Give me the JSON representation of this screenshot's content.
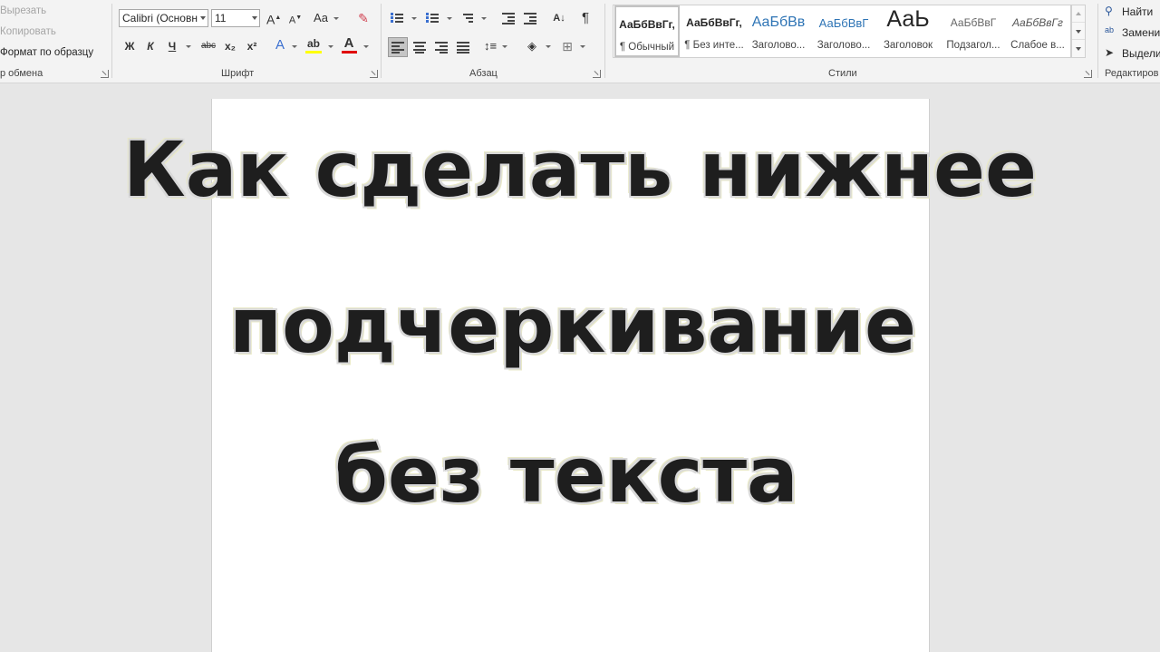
{
  "ribbon": {
    "clipboard": {
      "cut": "Вырезать",
      "copy": "Копировать",
      "format_painter": "Формат по образцу",
      "label": "р обмена"
    },
    "font": {
      "font_name": "Calibri (Основн",
      "font_size": "11",
      "grow": "A",
      "shrink": "A",
      "change_case": "Aa",
      "bold": "Ж",
      "italic": "К",
      "underline": "Ч",
      "strikethrough": "abc",
      "subscript": "x₂",
      "superscript": "x²",
      "text_effects": "A",
      "highlight": "ab",
      "font_color": "A",
      "label": "Шрифт",
      "highlight_color": "#ffff00",
      "font_color_value": "#e00000"
    },
    "paragraph": {
      "show_marks": "¶",
      "label": "Абзац"
    },
    "styles": {
      "label": "Стили",
      "items": [
        {
          "sample": "АаБбВвГг,",
          "name": "¶ Обычный"
        },
        {
          "sample": "АаБбВвГг,",
          "name": "¶ Без инте..."
        },
        {
          "sample": "АаБбВв",
          "name": "Заголово..."
        },
        {
          "sample": "АаБбВвГ",
          "name": "Заголово..."
        },
        {
          "sample": "АаЬ",
          "name": "Заголовок"
        },
        {
          "sample": "АаБбВвГ",
          "name": "Подзагол..."
        },
        {
          "sample": "АаБбВвГг",
          "name": "Слабое в..."
        }
      ]
    },
    "editing": {
      "find": "Найти",
      "replace": "Замени",
      "select": "Выдели",
      "label": "Редактиров"
    }
  },
  "overlay": {
    "line1": "Как сделать нижнее",
    "line2": "подчеркивание",
    "line3": "без текста"
  }
}
